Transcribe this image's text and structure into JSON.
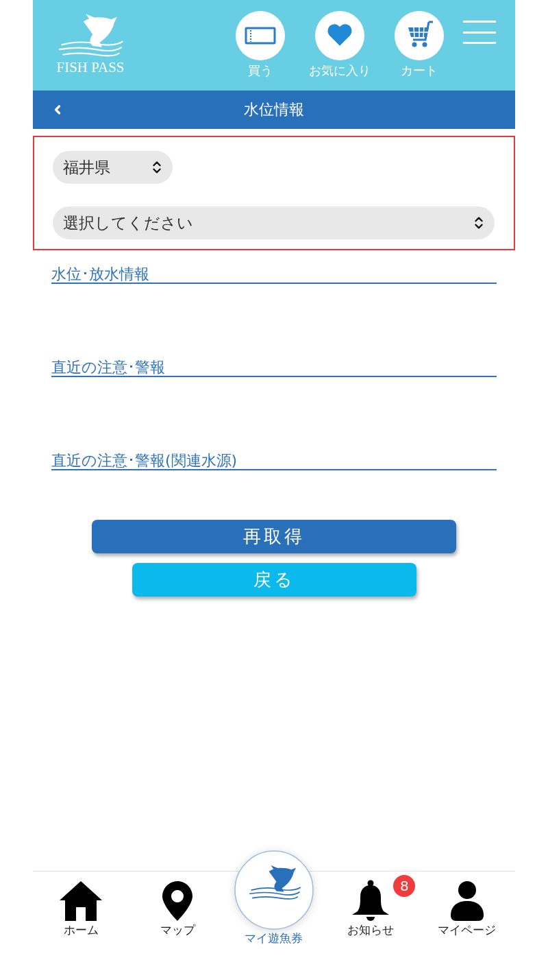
{
  "header": {
    "logo_text": "FISH PASS",
    "actions": [
      {
        "kind": "ticket",
        "label": "買う"
      },
      {
        "kind": "heart",
        "label": "お気に入り"
      },
      {
        "kind": "cart",
        "label": "カート"
      }
    ]
  },
  "title_bar": {
    "title": "水位情報"
  },
  "prefecture_select": {
    "value": "福井県"
  },
  "location_select": {
    "value": "選択してください"
  },
  "sections": [
    {
      "title": "水位･放水情報"
    },
    {
      "title": "直近の注意･警報"
    },
    {
      "title": "直近の注意･警報(関連水源)"
    }
  ],
  "buttons": [
    {
      "kind": "primary",
      "label": "再取得"
    },
    {
      "kind": "secondary",
      "label": "戻る"
    }
  ],
  "bottom_nav": [
    {
      "kind": "home",
      "label": "ホーム"
    },
    {
      "kind": "map",
      "label": "マップ"
    },
    {
      "kind": "pass",
      "label": "マイ遊魚券"
    },
    {
      "kind": "bell",
      "label": "お知らせ",
      "badge": "8"
    },
    {
      "kind": "person",
      "label": "マイページ"
    }
  ]
}
